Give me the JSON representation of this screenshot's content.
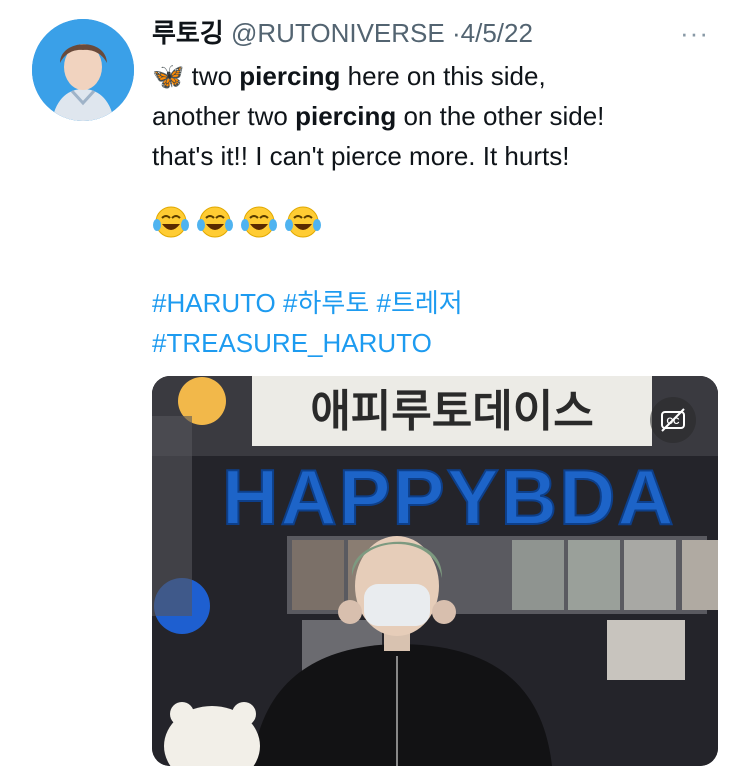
{
  "tweet": {
    "display_name": "루토깅",
    "handle": "@RUTONIVERSE",
    "separator": "·",
    "date": "4/5/22",
    "more_label": "···",
    "body": {
      "emoji_lead": "🦋",
      "l1_a": " two ",
      "l1_bold": "piercing",
      "l1_b": " here on this side,",
      "l2_a": "another two ",
      "l2_bold": "piercing",
      "l2_b": " on the other side!",
      "l3": "that's it!! I can't pierce more. It hurts!"
    },
    "emojis": [
      "😂",
      "😂",
      "😂",
      "😂"
    ],
    "hashtags": [
      "#HARUTO",
      "#하루토",
      "#트레저",
      "#TREASURE_HARUTO"
    ],
    "media": {
      "sign_text": "애피루토데이스",
      "balloon_text": "HAPPYBDA",
      "captions_icon": "closed-captions-off-icon"
    }
  },
  "colors": {
    "text": "#0f1419",
    "secondary": "#536471",
    "link": "#1d9bf0",
    "balloon": "#1d64c8"
  }
}
